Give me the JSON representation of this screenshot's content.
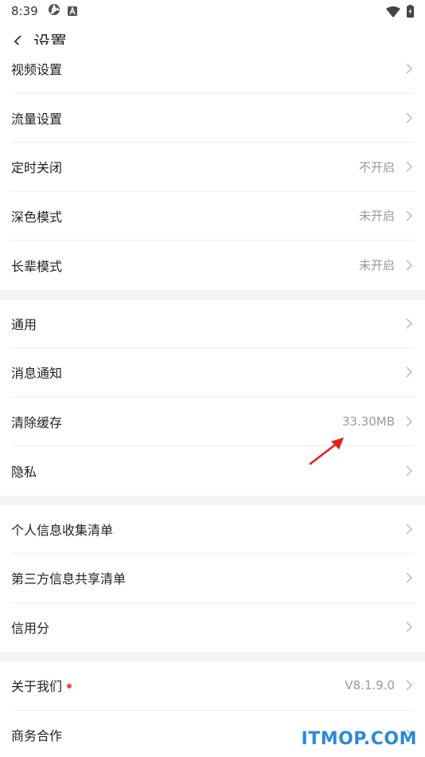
{
  "status_bar": {
    "time": "8:39"
  },
  "header": {
    "title": "设置"
  },
  "groups": [
    {
      "items": [
        {
          "label": "视频设置",
          "value": ""
        },
        {
          "label": "流量设置",
          "value": ""
        },
        {
          "label": "定时关闭",
          "value": "不开启"
        },
        {
          "label": "深色模式",
          "value": "未开启"
        },
        {
          "label": "长辈模式",
          "value": "未开启"
        }
      ]
    },
    {
      "items": [
        {
          "label": "通用",
          "value": ""
        },
        {
          "label": "消息通知",
          "value": ""
        },
        {
          "label": "清除缓存",
          "value": "33.30MB"
        },
        {
          "label": "隐私",
          "value": ""
        }
      ]
    },
    {
      "items": [
        {
          "label": "个人信息收集清单",
          "value": ""
        },
        {
          "label": "第三方信息共享清单",
          "value": ""
        },
        {
          "label": "信用分",
          "value": ""
        }
      ]
    },
    {
      "items": [
        {
          "label": "关于我们",
          "value": "V8.1.9.0"
        },
        {
          "label": "商务合作",
          "value": ""
        }
      ]
    }
  ],
  "watermark": "ITMOP.COM",
  "colors": {
    "background_gap": "#f4f4f4",
    "value_text": "#999999",
    "badge_dot": "#f04a3a",
    "annotation_arrow": "#e0201a",
    "watermark": "#2b8ad6"
  }
}
